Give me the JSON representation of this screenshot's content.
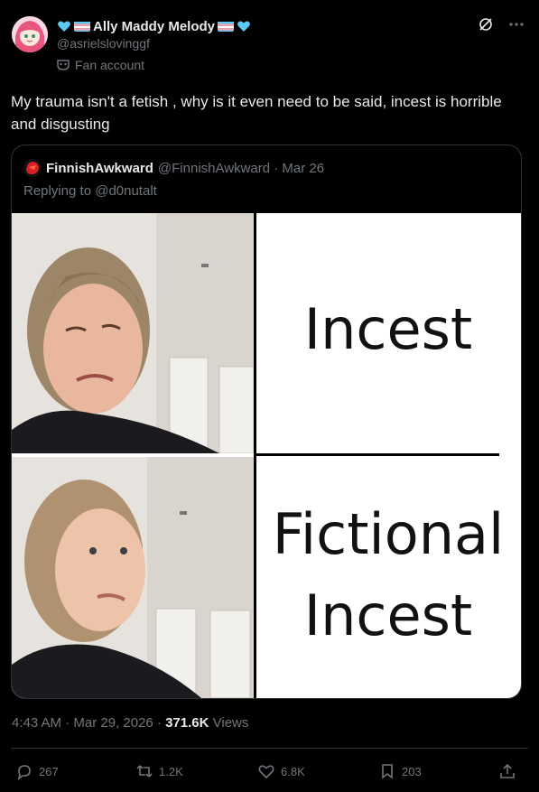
{
  "author": {
    "display_name": "Ally Maddy Melody",
    "handle": "@asrielslovinggf",
    "label": "Fan account"
  },
  "tweet_text": "My trauma isn't a fetish , why is it even need to be said, incest is horrible and disgusting",
  "quoted": {
    "display_name": "FinnishAwkward",
    "handle_meta": "@FinnishAwkward · Mar 26",
    "replying_to": "Replying to @d0nutalt",
    "meme_top_text": "Incest",
    "meme_bottom_line1": "Fictional",
    "meme_bottom_line2": "Incest"
  },
  "meta": {
    "time_date": "4:43 AM · Mar 29, 2026 · ",
    "views_count": "371.6K",
    "views_label": " Views"
  },
  "actions": {
    "replies": "267",
    "reposts": "1.2K",
    "likes": "6.8K",
    "bookmarks": "203"
  },
  "colors": {
    "background": "#000000",
    "text": "#e7e9ea",
    "muted": "#71767b",
    "border": "#2f3336",
    "heart": "#5bc8f5"
  },
  "icons": [
    "heart-icon",
    "trans-flag-icon",
    "grok-icon",
    "more-icon",
    "mask-icon",
    "reply-icon",
    "repost-icon",
    "like-icon",
    "bookmark-icon",
    "share-icon"
  ]
}
